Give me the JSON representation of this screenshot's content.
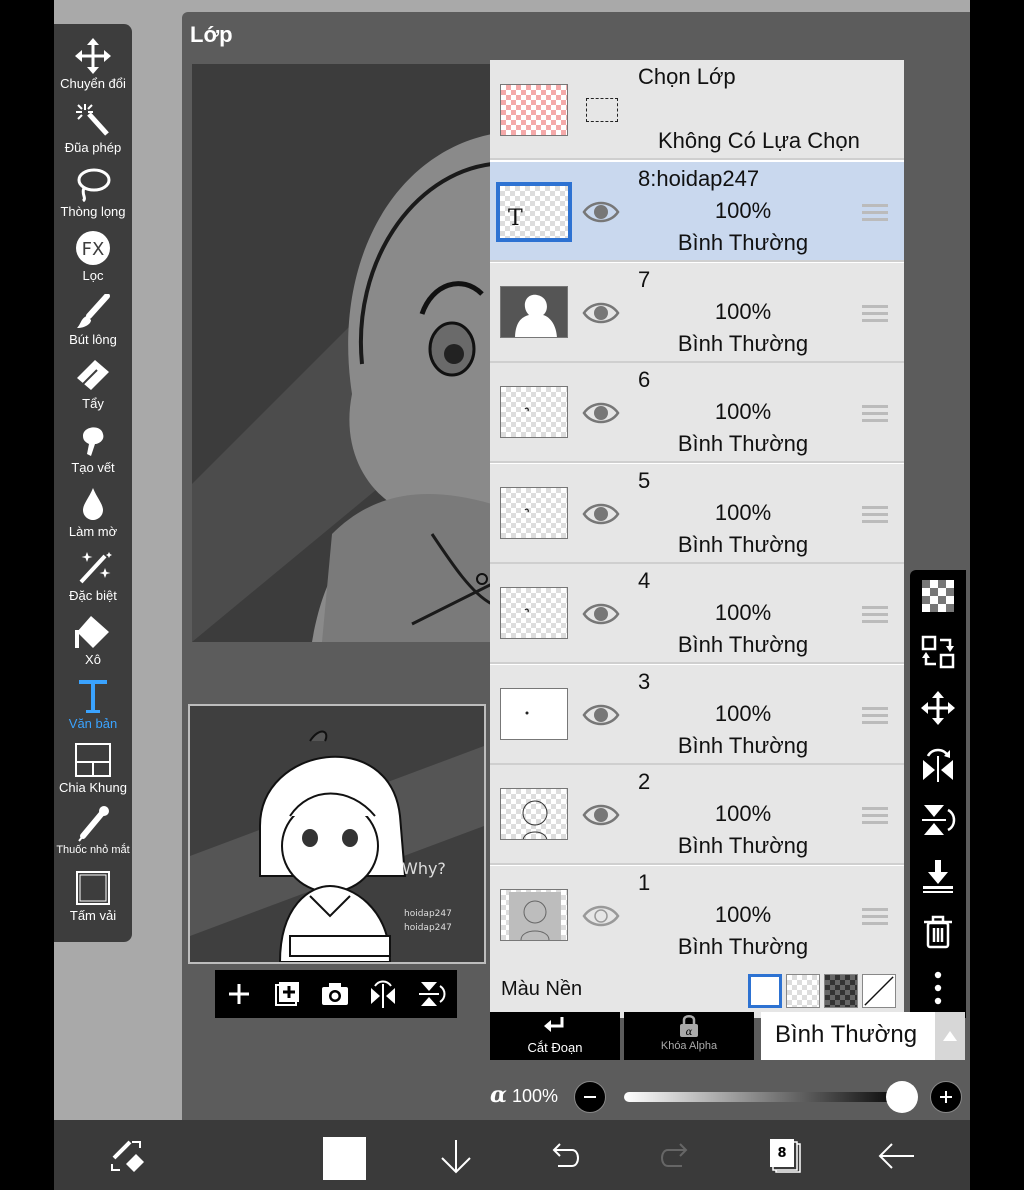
{
  "window": {
    "title": "Lớp"
  },
  "toolbar": {
    "tools": [
      {
        "label": "Chuyển đổi",
        "icon": "move-icon"
      },
      {
        "label": "Đũa phép",
        "icon": "magic-wand-icon"
      },
      {
        "label": "Thòng lọng",
        "icon": "lasso-icon"
      },
      {
        "label": "Lọc",
        "icon": "fx-filter-icon"
      },
      {
        "label": "Bút lông",
        "icon": "brush-icon"
      },
      {
        "label": "Tẩy",
        "icon": "eraser-icon"
      },
      {
        "label": "Tạo vết",
        "icon": "smudge-icon"
      },
      {
        "label": "Làm mờ",
        "icon": "blur-icon"
      },
      {
        "label": "Đặc biệt",
        "icon": "special-brush-icon"
      },
      {
        "label": "Xô",
        "icon": "bucket-icon"
      },
      {
        "label": "Văn bản",
        "icon": "text-icon",
        "active": true
      },
      {
        "label": "Chia Khung",
        "icon": "frame-divider-icon"
      },
      {
        "label": "Thuốc nhỏ mắt",
        "icon": "eyedropper-icon"
      },
      {
        "label": "Tấm vải",
        "icon": "canvas-icon"
      }
    ]
  },
  "selection": {
    "title": "Chọn Lớp",
    "status": "Không Có Lựa Chọn"
  },
  "layers": [
    {
      "name": "8:hoidap247",
      "opacity": "100%",
      "mode": "Bình Thường",
      "selected": true,
      "visible": true
    },
    {
      "name": "7",
      "opacity": "100%",
      "mode": "Bình Thường",
      "selected": false,
      "visible": true
    },
    {
      "name": "6",
      "opacity": "100%",
      "mode": "Bình Thường",
      "selected": false,
      "visible": true
    },
    {
      "name": "5",
      "opacity": "100%",
      "mode": "Bình Thường",
      "selected": false,
      "visible": true
    },
    {
      "name": "4",
      "opacity": "100%",
      "mode": "Bình Thường",
      "selected": false,
      "visible": true
    },
    {
      "name": "3",
      "opacity": "100%",
      "mode": "Bình Thường",
      "selected": false,
      "visible": true
    },
    {
      "name": "2",
      "opacity": "100%",
      "mode": "Bình Thường",
      "selected": false,
      "visible": true
    },
    {
      "name": "1",
      "opacity": "100%",
      "mode": "Bình Thường",
      "selected": false,
      "visible": false
    }
  ],
  "background": {
    "label": "Màu Nền"
  },
  "controls": {
    "clip_label": "Cắt Đoạn",
    "alpha_lock_label": "Khóa Alpha",
    "blend_mode": "Bình Thường",
    "alpha_symbol": "α",
    "alpha_value": "100%",
    "alpha_fraction": 1.0
  },
  "thumbnail": {
    "watermark_text": "Why?",
    "text_lines": [
      "hoidap247",
      "hoidap247"
    ]
  },
  "bottom_bar": {
    "layer_count": "8"
  },
  "colors": {
    "accent": "#2d72d2",
    "active_tool": "#3aa3ff",
    "selected_row": "#c9d8ee"
  }
}
